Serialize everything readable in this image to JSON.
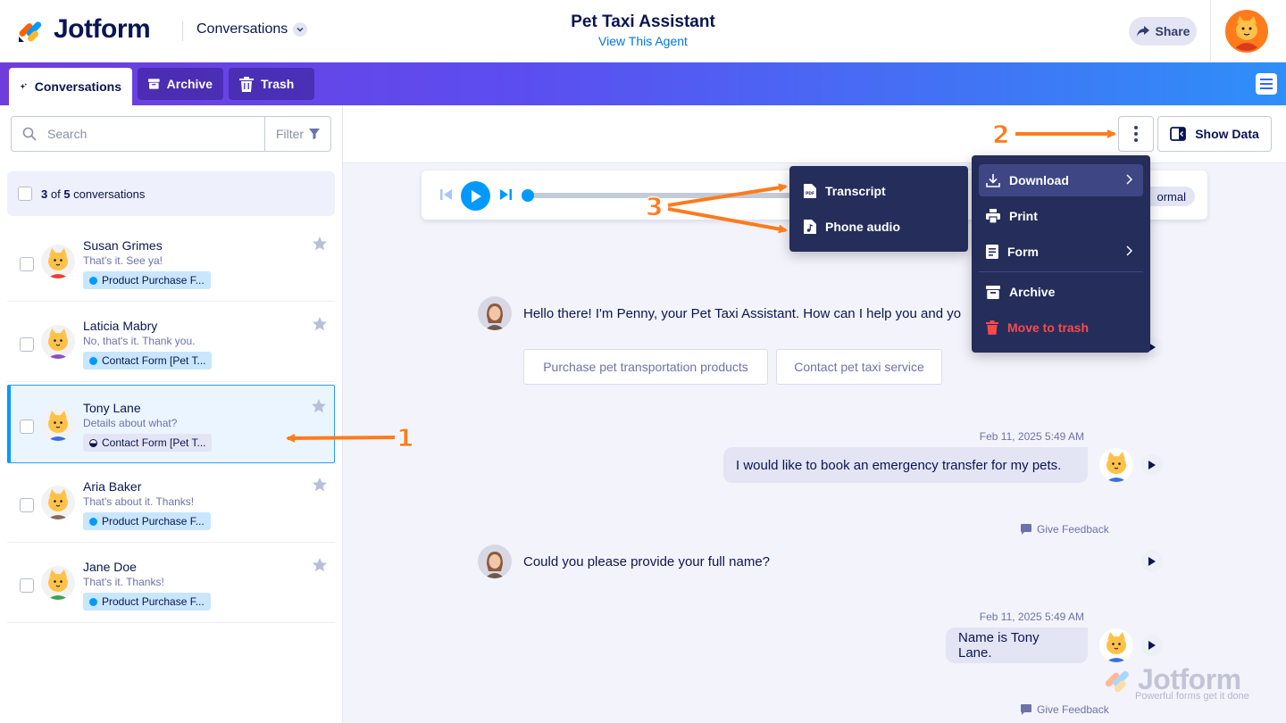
{
  "header": {
    "brand": "Jotform",
    "section_switch": "Conversations",
    "agent_title": "Pet Taxi Assistant",
    "agent_link": "View This Agent",
    "share_label": "Share"
  },
  "tabs": [
    {
      "label": "Conversations",
      "icon": "sparkle-icon",
      "active": true
    },
    {
      "label": "Archive",
      "icon": "archive-icon",
      "active": false
    },
    {
      "label": "Trash",
      "icon": "trash-icon",
      "active": false
    }
  ],
  "sidebar": {
    "search_placeholder": "Search",
    "filter_label": "Filter",
    "count_bold_a": "3",
    "count_mid": " of ",
    "count_bold_b": "5",
    "count_suffix": " conversations",
    "conversations": [
      {
        "name": "Susan Grimes",
        "preview": "That's it. See ya!",
        "tag": "Product Purchase F...",
        "avatar_color": "#e8402f",
        "selected": false
      },
      {
        "name": "Laticia Mabry",
        "preview": "No, that's it. Thank you.",
        "tag": "Contact Form [Pet T...",
        "avatar_color": "#8a4fc2",
        "selected": false
      },
      {
        "name": "Tony Lane",
        "preview": "Details about what?",
        "tag": "Contact Form [Pet T...",
        "avatar_color": "#3a6fd8",
        "selected": true
      },
      {
        "name": "Aria Baker",
        "preview": "That's about it. Thanks!",
        "tag": "Product Purchase F...",
        "avatar_color": "#8a6a58",
        "selected": false
      },
      {
        "name": "Jane Doe",
        "preview": "That's it. Thanks!",
        "tag": "Product Purchase F...",
        "avatar_color": "#3aa64a",
        "selected": false
      }
    ]
  },
  "toolbar": {
    "show_data_label": "Show Data"
  },
  "player": {
    "speed_label": "ormal"
  },
  "chat": {
    "greeting": "Hello there! I'm Penny, your Pet Taxi Assistant. How can I help you and yo",
    "chips": [
      "Purchase pet transportation products",
      "Contact pet taxi service"
    ],
    "messages": [
      {
        "timestamp": "Feb 11, 2025 5:49 AM",
        "text": "I would like to book an emergency transfer for my pets."
      },
      {
        "timestamp": "Feb 11, 2025 5:49 AM",
        "text": "Name is Tony Lane."
      }
    ],
    "bot_question": "Could you please provide your full name?",
    "feedback_label": "Give Feedback"
  },
  "menu": {
    "items": [
      {
        "label": "Download",
        "icon": "download-icon",
        "submenu": true,
        "highlighted": true
      },
      {
        "label": "Print",
        "icon": "print-icon",
        "submenu": false
      },
      {
        "label": "Form",
        "icon": "form-icon",
        "submenu": true
      },
      {
        "label": "Archive",
        "icon": "archive-icon",
        "submenu": false
      },
      {
        "label": "Move to trash",
        "icon": "trash-icon",
        "submenu": false,
        "danger": true
      }
    ],
    "download_submenu": [
      {
        "label": "Transcript",
        "icon": "pdf-file-icon"
      },
      {
        "label": "Phone audio",
        "icon": "audio-file-icon"
      }
    ]
  },
  "annotations": [
    "1",
    "2",
    "3"
  ],
  "watermark": {
    "brand": "Jotform",
    "slogan": "Powerful forms get it done"
  },
  "colors": {
    "accent": "#0099ff",
    "navy": "#0a1551",
    "menu_bg": "#252d5b",
    "danger": "#f94a4a",
    "annotation": "#ff7b1c"
  }
}
